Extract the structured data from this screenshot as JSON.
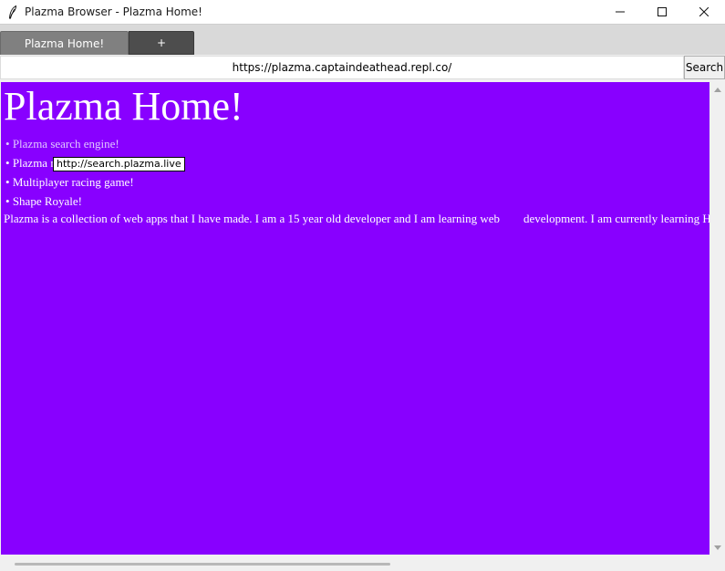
{
  "window": {
    "title": "Plazma Browser - Plazma Home!",
    "controls": [
      "minimize-icon",
      "maximize-icon",
      "close-icon"
    ]
  },
  "tabs": {
    "active_label": "Plazma Home!",
    "new_tab_label": "+"
  },
  "address_bar": {
    "url": "https://plazma.captaindeathead.repl.co/",
    "search_label": "Search"
  },
  "page": {
    "heading": "Plazma Home!",
    "links": [
      {
        "label": "Plazma search engine!"
      },
      {
        "label": "Plazma n"
      },
      {
        "label": "Multiplayer racing game!"
      },
      {
        "label": "Shape Royale!"
      }
    ],
    "tooltip": "http://search.plazma.live",
    "description": "Plazma is a collection of web apps that I have made. I am a 15 year old developer and I am learning web        development. I am currently learning HT"
  },
  "colors": {
    "page_background": "#8800ff",
    "text": "#ffffff",
    "visited_link": "#e0c8ff"
  }
}
